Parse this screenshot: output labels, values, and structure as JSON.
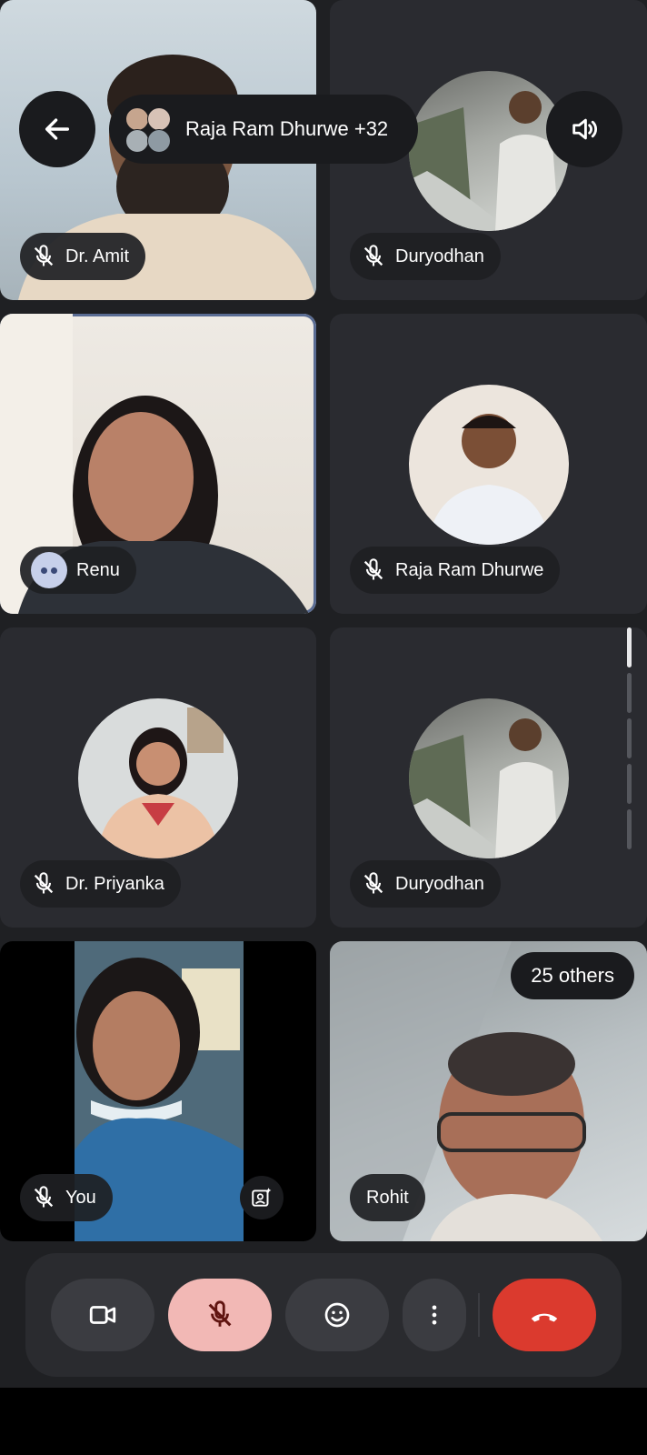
{
  "header": {
    "meeting_title": "Raja Ram Dhurwe +32"
  },
  "participants": [
    {
      "name": "Dr. Amit",
      "muted": true
    },
    {
      "name": "Duryodhan",
      "muted": true
    },
    {
      "name": "Renu",
      "speaking": true
    },
    {
      "name": "Raja Ram Dhurwe",
      "muted": true
    },
    {
      "name": "Dr. Priyanka",
      "muted": true
    },
    {
      "name": "Duryodhan",
      "muted": true
    },
    {
      "name": "You",
      "muted": true
    },
    {
      "name": "Rohit"
    }
  ],
  "others": {
    "label": "25 others"
  },
  "controls": {
    "camera_icon": "videocam-icon",
    "mic_icon": "mic-off-icon",
    "emoji_icon": "emoji-icon",
    "more_icon": "more-vert-icon",
    "hangup_icon": "call-end-icon"
  },
  "colors": {
    "background": "#1f2023",
    "tile": "#2a2b30",
    "mic_muted_button": "#f2b8b5",
    "hangup": "#db3a2e",
    "selected_border": "#5a6c93"
  }
}
